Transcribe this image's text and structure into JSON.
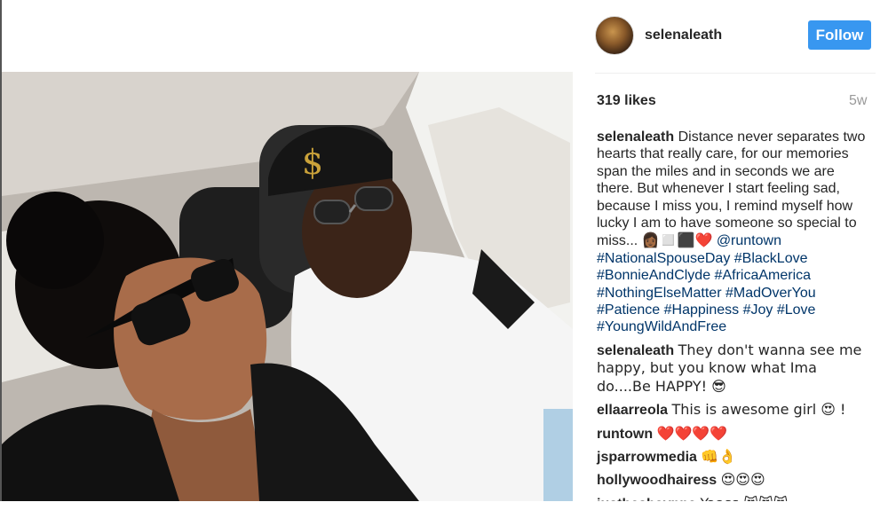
{
  "post": {
    "username": "selenaleath",
    "follow_label": "Follow",
    "likes": "319 likes",
    "age": "5w"
  },
  "caption": {
    "author": "selenaleath",
    "text": "Distance never separates two hearts that really care, for our memories span the miles and in seconds we are there. But whenever I start feeling sad, because I miss you, I remind myself how lucky I am to have someone so special to miss...",
    "emojis": "👩🏾◻️⬛❤️",
    "mention": "@runtown",
    "hashtags": [
      "#NationalSpouseDay",
      "#BlackLove",
      "#BonnieAndClyde",
      "#AfricaAmerica",
      "#NothingElseMatter",
      "#MadOverYou",
      "#Patience",
      "#Happiness",
      "#Joy",
      "#Love",
      "#YoungWildAndFree"
    ]
  },
  "comments": [
    {
      "author": "selenaleath",
      "text": "They don't wanna see me happy, but you know what Ima do....Be HAPPY! 😎"
    },
    {
      "author": "ellaarreola",
      "text": "This is awesome girl 😍 !"
    },
    {
      "author": "runtown",
      "text": "❤️❤️❤️❤️"
    },
    {
      "author": "jsparrowmedia",
      "text": "👊👌"
    },
    {
      "author": "hollywoodhairess",
      "text": "😍😍😍"
    },
    {
      "author": "justbeshavnna",
      "text": "Yaass 😻😻😻"
    }
  ],
  "colors": {
    "follow_bg": "#3897f0",
    "hashtag": "#003569",
    "muted": "#999999"
  }
}
